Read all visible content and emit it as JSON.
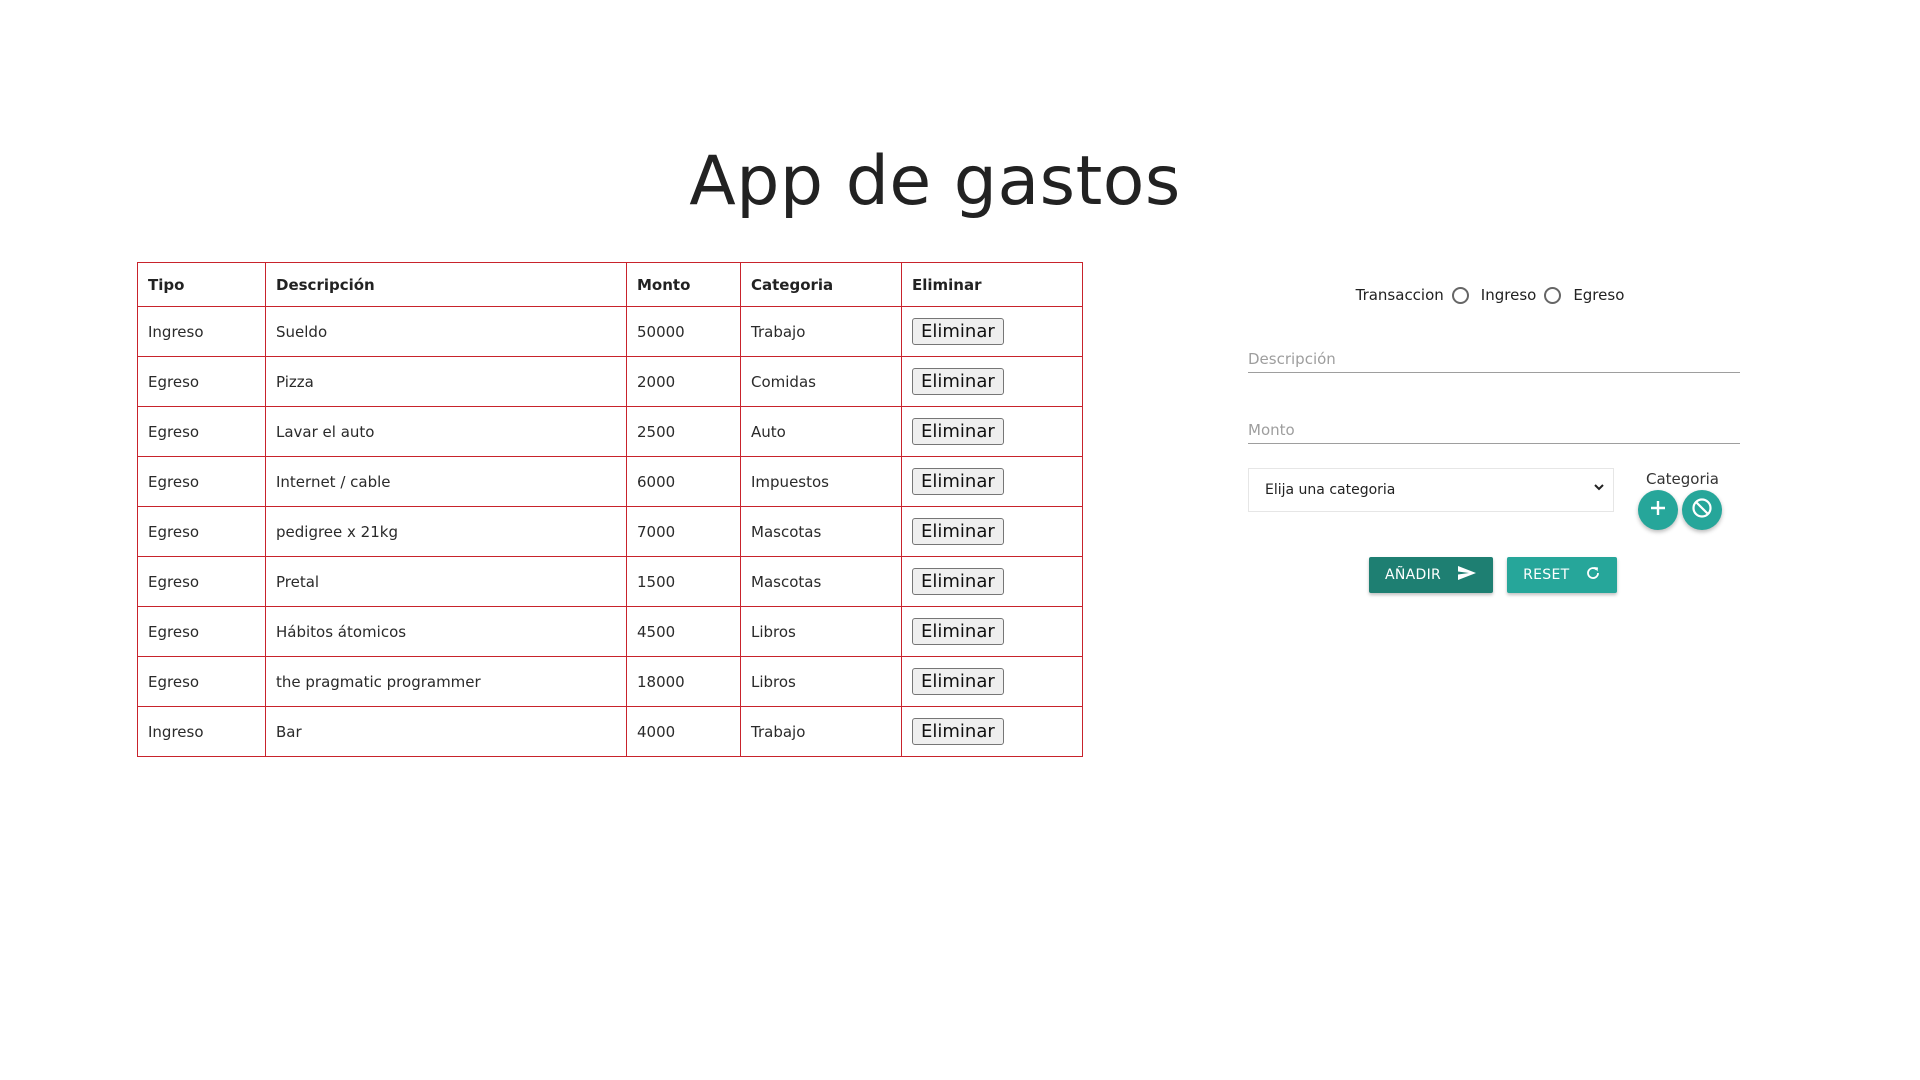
{
  "app": {
    "title": "App de gastos"
  },
  "table": {
    "headers": [
      "Tipo",
      "Descripción",
      "Monto",
      "Categoria",
      "Eliminar"
    ],
    "rows": [
      {
        "tipo": "Ingreso",
        "descripcion": "Sueldo",
        "monto": "50000",
        "categoria": "Trabajo",
        "accion": "Eliminar"
      },
      {
        "tipo": "Egreso",
        "descripcion": "Pizza",
        "monto": "2000",
        "categoria": "Comidas",
        "accion": "Eliminar"
      },
      {
        "tipo": "Egreso",
        "descripcion": "Lavar el auto",
        "monto": "2500",
        "categoria": "Auto",
        "accion": "Eliminar"
      },
      {
        "tipo": "Egreso",
        "descripcion": "Internet / cable",
        "monto": "6000",
        "categoria": "Impuestos",
        "accion": "Eliminar"
      },
      {
        "tipo": "Egreso",
        "descripcion": "pedigree x 21kg",
        "monto": "7000",
        "categoria": "Mascotas",
        "accion": "Eliminar"
      },
      {
        "tipo": "Egreso",
        "descripcion": "Pretal",
        "monto": "1500",
        "categoria": "Mascotas",
        "accion": "Eliminar"
      },
      {
        "tipo": "Egreso",
        "descripcion": "Hábitos átomicos",
        "monto": "4500",
        "categoria": "Libros",
        "accion": "Eliminar"
      },
      {
        "tipo": "Egreso",
        "descripcion": "the pragmatic programmer",
        "monto": "18000",
        "categoria": "Libros",
        "accion": "Eliminar"
      },
      {
        "tipo": "Ingreso",
        "descripcion": "Bar",
        "monto": "4000",
        "categoria": "Trabajo",
        "accion": "Eliminar"
      }
    ]
  },
  "form": {
    "transaction_label": "Transaccion",
    "option_income": "Ingreso",
    "option_expense": "Egreso",
    "description_placeholder": "Descripción",
    "description_value": "",
    "amount_placeholder": "Monto",
    "amount_value": "",
    "category_select_value": "Elija una categoria",
    "category_label": "Categoria",
    "add_button_label": "AÑADIR",
    "reset_button_label": "RESET"
  },
  "icons": {
    "add_category": "plus-icon",
    "block_category": "block-icon",
    "send": "send-icon",
    "reset": "refresh-icon",
    "select": "chevron-down-icon"
  },
  "colors": {
    "table_border": "#c8232c",
    "accent_dark": "#1e7f72",
    "accent": "#26a69a"
  }
}
